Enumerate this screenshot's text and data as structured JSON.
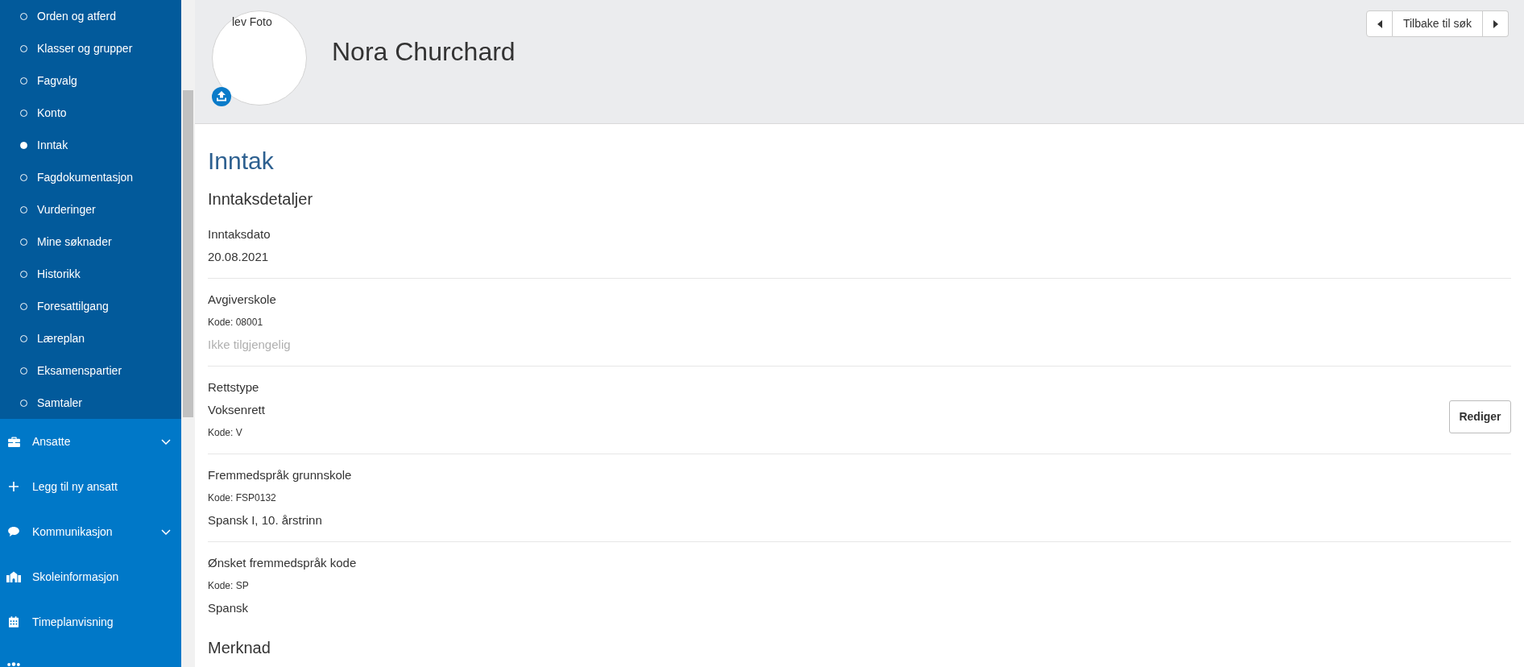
{
  "sidebar": {
    "sub_items": [
      {
        "label": "Orden og atferd",
        "selected": false
      },
      {
        "label": "Klasser og grupper",
        "selected": false
      },
      {
        "label": "Fagvalg",
        "selected": false
      },
      {
        "label": "Konto",
        "selected": false
      },
      {
        "label": "Inntak",
        "selected": true
      },
      {
        "label": "Fagdokumentasjon",
        "selected": false
      },
      {
        "label": "Vurderinger",
        "selected": false
      },
      {
        "label": "Mine søknader",
        "selected": false
      },
      {
        "label": "Historikk",
        "selected": false
      },
      {
        "label": "Foresattilgang",
        "selected": false
      },
      {
        "label": "Læreplan",
        "selected": false
      },
      {
        "label": "Eksamenspartier",
        "selected": false
      },
      {
        "label": "Samtaler",
        "selected": false
      }
    ],
    "items": [
      {
        "label": "Ansatte",
        "expandable": true
      },
      {
        "label": "Legg til ny ansatt",
        "expandable": false
      },
      {
        "label": "Kommunikasjon",
        "expandable": true
      },
      {
        "label": "Skoleinformasjon",
        "expandable": false
      },
      {
        "label": "Timeplanvisning",
        "expandable": false
      },
      {
        "expandable": false
      }
    ]
  },
  "header": {
    "photo_text": "lev Foto",
    "name": "Nora Churchard",
    "back_button": "Tilbake til søk"
  },
  "page": {
    "title": "Inntak",
    "subtitle": "Inntaksdetaljer",
    "sections": [
      {
        "lines": [
          {
            "kind": "label",
            "text": "Inntaksdato"
          },
          {
            "kind": "value",
            "text": "20.08.2021"
          }
        ]
      },
      {
        "lines": [
          {
            "kind": "label",
            "text": "Avgiverskole"
          },
          {
            "kind": "code",
            "text": "Kode: 08001"
          },
          {
            "kind": "missing",
            "text": "Ikke tilgjengelig"
          }
        ]
      },
      {
        "lines": [
          {
            "kind": "label",
            "text": "Rettstype"
          },
          {
            "kind": "value",
            "text": "Voksenrett"
          },
          {
            "kind": "code",
            "text": "Kode: V"
          }
        ],
        "button": "Rediger"
      },
      {
        "lines": [
          {
            "kind": "label",
            "text": "Fremmedspråk grunnskole"
          },
          {
            "kind": "code",
            "text": "Kode: FSP0132"
          },
          {
            "kind": "value",
            "text": "Spansk I, 10. årstrinn"
          }
        ]
      },
      {
        "lines": [
          {
            "kind": "label",
            "text": "Ønsket fremmedspråk kode"
          },
          {
            "kind": "code",
            "text": "Kode: SP"
          },
          {
            "kind": "value",
            "text": "Spansk"
          }
        ]
      }
    ],
    "next_heading": "Merknad"
  }
}
